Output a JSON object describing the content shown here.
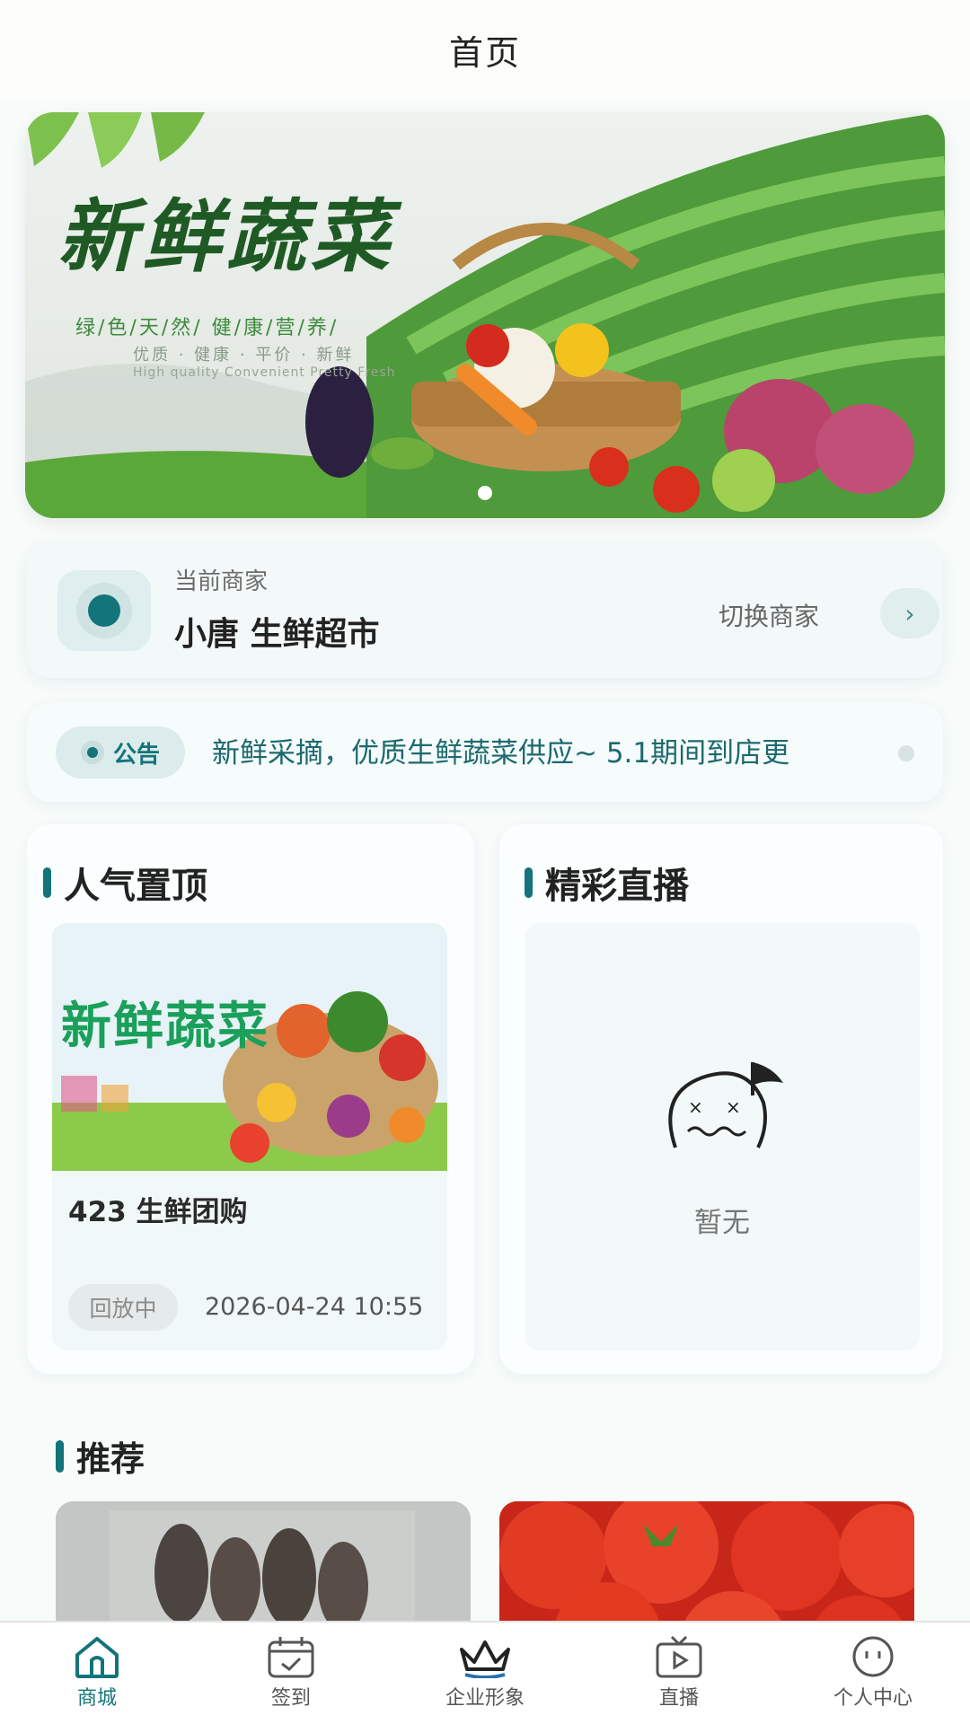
{
  "header": {
    "title": "首页"
  },
  "banner": {
    "title": "新鲜蔬菜",
    "subtitle1": "绿/色/天/然/  健/康/营/养/",
    "subtitle2": "优质 · 健康 · 平价 · 新鲜",
    "subtitle3": "High quality Convenient Pretty Fresh",
    "page_count": 1,
    "active_page": 1
  },
  "merchant": {
    "label": "当前商家",
    "name": "小唐 生鲜超市",
    "switch_label": "切换商家",
    "switch_icon": "chevron-right-icon"
  },
  "notice": {
    "badge": "公告",
    "text": "新鲜采摘，优质生鲜蔬菜供应~ 5.1期间到店更"
  },
  "popular": {
    "title": "人气置顶",
    "item": {
      "name": "423 生鲜团购",
      "image_title": "新鲜蔬菜",
      "status": "回放中",
      "time": "2026-04-24 10:55"
    }
  },
  "live": {
    "title": "精彩直播",
    "empty_text": "暂无",
    "empty_icon": "empty-face-flag-icon"
  },
  "recommend": {
    "title": "推荐"
  },
  "tabbar": {
    "items": [
      {
        "label": "商城",
        "icon": "home-icon",
        "active": true
      },
      {
        "label": "签到",
        "icon": "calendar-check-icon",
        "active": false
      },
      {
        "label": "企业形象",
        "icon": "crown-icon",
        "active": false
      },
      {
        "label": "直播",
        "icon": "tv-play-icon",
        "active": false
      },
      {
        "label": "个人中心",
        "icon": "face-icon",
        "active": false
      }
    ]
  },
  "colors": {
    "accent": "#137479",
    "background": "#f7fbfa",
    "card": "#f3f9f9"
  }
}
